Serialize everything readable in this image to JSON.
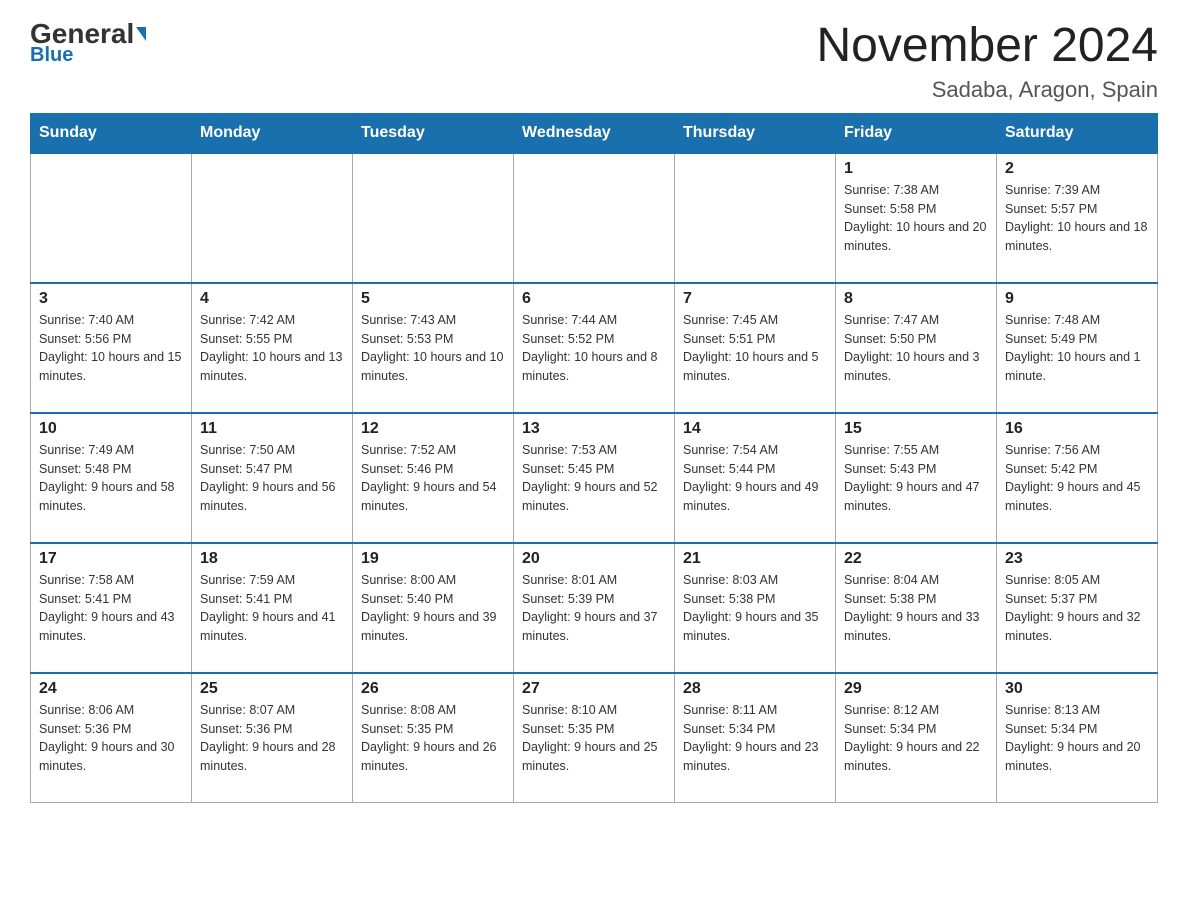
{
  "logo": {
    "general": "General",
    "blue": "Blue"
  },
  "title": {
    "month_year": "November 2024",
    "location": "Sadaba, Aragon, Spain"
  },
  "days_of_week": [
    "Sunday",
    "Monday",
    "Tuesday",
    "Wednesday",
    "Thursday",
    "Friday",
    "Saturday"
  ],
  "weeks": [
    [
      {
        "day": "",
        "info": ""
      },
      {
        "day": "",
        "info": ""
      },
      {
        "day": "",
        "info": ""
      },
      {
        "day": "",
        "info": ""
      },
      {
        "day": "",
        "info": ""
      },
      {
        "day": "1",
        "info": "Sunrise: 7:38 AM\nSunset: 5:58 PM\nDaylight: 10 hours and 20 minutes."
      },
      {
        "day": "2",
        "info": "Sunrise: 7:39 AM\nSunset: 5:57 PM\nDaylight: 10 hours and 18 minutes."
      }
    ],
    [
      {
        "day": "3",
        "info": "Sunrise: 7:40 AM\nSunset: 5:56 PM\nDaylight: 10 hours and 15 minutes."
      },
      {
        "day": "4",
        "info": "Sunrise: 7:42 AM\nSunset: 5:55 PM\nDaylight: 10 hours and 13 minutes."
      },
      {
        "day": "5",
        "info": "Sunrise: 7:43 AM\nSunset: 5:53 PM\nDaylight: 10 hours and 10 minutes."
      },
      {
        "day": "6",
        "info": "Sunrise: 7:44 AM\nSunset: 5:52 PM\nDaylight: 10 hours and 8 minutes."
      },
      {
        "day": "7",
        "info": "Sunrise: 7:45 AM\nSunset: 5:51 PM\nDaylight: 10 hours and 5 minutes."
      },
      {
        "day": "8",
        "info": "Sunrise: 7:47 AM\nSunset: 5:50 PM\nDaylight: 10 hours and 3 minutes."
      },
      {
        "day": "9",
        "info": "Sunrise: 7:48 AM\nSunset: 5:49 PM\nDaylight: 10 hours and 1 minute."
      }
    ],
    [
      {
        "day": "10",
        "info": "Sunrise: 7:49 AM\nSunset: 5:48 PM\nDaylight: 9 hours and 58 minutes."
      },
      {
        "day": "11",
        "info": "Sunrise: 7:50 AM\nSunset: 5:47 PM\nDaylight: 9 hours and 56 minutes."
      },
      {
        "day": "12",
        "info": "Sunrise: 7:52 AM\nSunset: 5:46 PM\nDaylight: 9 hours and 54 minutes."
      },
      {
        "day": "13",
        "info": "Sunrise: 7:53 AM\nSunset: 5:45 PM\nDaylight: 9 hours and 52 minutes."
      },
      {
        "day": "14",
        "info": "Sunrise: 7:54 AM\nSunset: 5:44 PM\nDaylight: 9 hours and 49 minutes."
      },
      {
        "day": "15",
        "info": "Sunrise: 7:55 AM\nSunset: 5:43 PM\nDaylight: 9 hours and 47 minutes."
      },
      {
        "day": "16",
        "info": "Sunrise: 7:56 AM\nSunset: 5:42 PM\nDaylight: 9 hours and 45 minutes."
      }
    ],
    [
      {
        "day": "17",
        "info": "Sunrise: 7:58 AM\nSunset: 5:41 PM\nDaylight: 9 hours and 43 minutes."
      },
      {
        "day": "18",
        "info": "Sunrise: 7:59 AM\nSunset: 5:41 PM\nDaylight: 9 hours and 41 minutes."
      },
      {
        "day": "19",
        "info": "Sunrise: 8:00 AM\nSunset: 5:40 PM\nDaylight: 9 hours and 39 minutes."
      },
      {
        "day": "20",
        "info": "Sunrise: 8:01 AM\nSunset: 5:39 PM\nDaylight: 9 hours and 37 minutes."
      },
      {
        "day": "21",
        "info": "Sunrise: 8:03 AM\nSunset: 5:38 PM\nDaylight: 9 hours and 35 minutes."
      },
      {
        "day": "22",
        "info": "Sunrise: 8:04 AM\nSunset: 5:38 PM\nDaylight: 9 hours and 33 minutes."
      },
      {
        "day": "23",
        "info": "Sunrise: 8:05 AM\nSunset: 5:37 PM\nDaylight: 9 hours and 32 minutes."
      }
    ],
    [
      {
        "day": "24",
        "info": "Sunrise: 8:06 AM\nSunset: 5:36 PM\nDaylight: 9 hours and 30 minutes."
      },
      {
        "day": "25",
        "info": "Sunrise: 8:07 AM\nSunset: 5:36 PM\nDaylight: 9 hours and 28 minutes."
      },
      {
        "day": "26",
        "info": "Sunrise: 8:08 AM\nSunset: 5:35 PM\nDaylight: 9 hours and 26 minutes."
      },
      {
        "day": "27",
        "info": "Sunrise: 8:10 AM\nSunset: 5:35 PM\nDaylight: 9 hours and 25 minutes."
      },
      {
        "day": "28",
        "info": "Sunrise: 8:11 AM\nSunset: 5:34 PM\nDaylight: 9 hours and 23 minutes."
      },
      {
        "day": "29",
        "info": "Sunrise: 8:12 AM\nSunset: 5:34 PM\nDaylight: 9 hours and 22 minutes."
      },
      {
        "day": "30",
        "info": "Sunrise: 8:13 AM\nSunset: 5:34 PM\nDaylight: 9 hours and 20 minutes."
      }
    ]
  ]
}
